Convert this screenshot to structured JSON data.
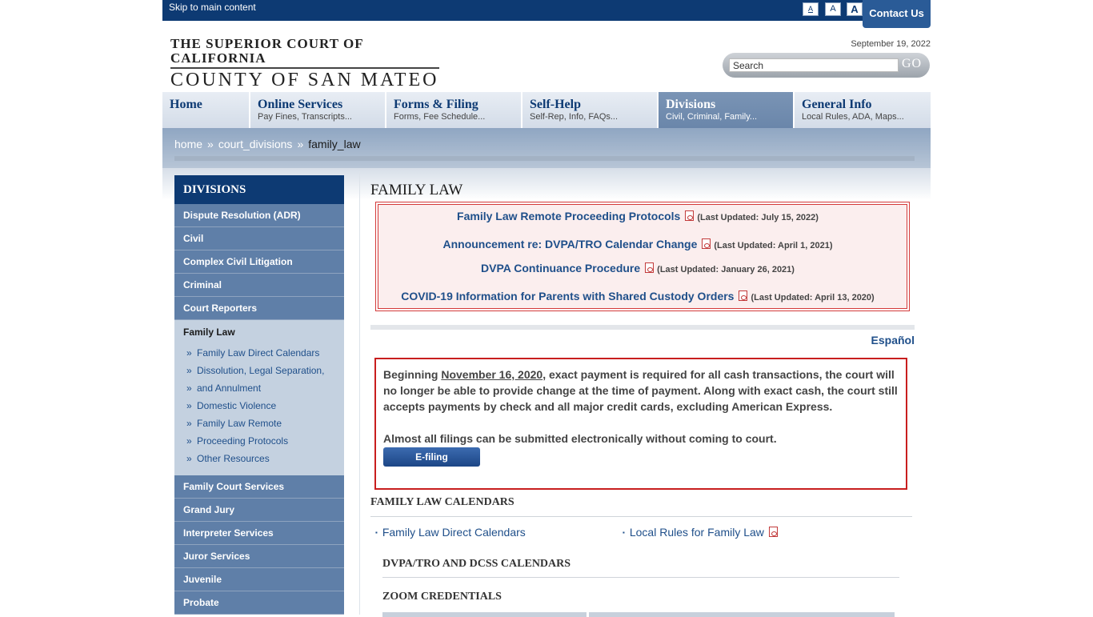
{
  "topbar": {
    "skip_link": "Skip to main content",
    "font_small": "A",
    "font_medium": "A",
    "font_large": "A",
    "contact": "Contact Us"
  },
  "header": {
    "logo_line1": "THE SUPERIOR COURT OF CALIFORNIA",
    "logo_line2": "COUNTY OF SAN MATEO",
    "date": "September 19, 2022",
    "search_placeholder": "Search",
    "go_label": "GO"
  },
  "nav": [
    {
      "title": "Home",
      "sub": ""
    },
    {
      "title": "Online Services",
      "sub": "Pay Fines, Transcripts..."
    },
    {
      "title": "Forms & Filing",
      "sub": "Forms, Fee Schedule..."
    },
    {
      "title": "Self-Help",
      "sub": "Self-Rep, Info, FAQs..."
    },
    {
      "title": "Divisions",
      "sub": "Civil, Criminal, Family..."
    },
    {
      "title": "General Info",
      "sub": "Local Rules, ADA, Maps..."
    }
  ],
  "breadcrumb": {
    "items": [
      "home",
      "court_divisions",
      "family_law"
    ],
    "separator": "»"
  },
  "sidebar": {
    "heading": "DIVISIONS",
    "items_top": [
      "Dispute Resolution (ADR)",
      "Civil",
      "Complex Civil Litigation",
      "Criminal",
      "Court Reporters"
    ],
    "active": "Family Law",
    "subitems": [
      "Family Law Direct Calendars",
      "Dissolution, Legal Separation,",
      "and Annulment",
      "Domestic Violence",
      "Family Law Remote",
      "Proceeding Protocols",
      "Other Resources"
    ],
    "items_bottom": [
      "Family Court Services",
      "Grand Jury",
      "Interpreter Services",
      "Juror Services",
      "Juvenile",
      "Probate"
    ]
  },
  "main": {
    "title": "FAMILY LAW",
    "alerts": [
      {
        "link": "Family Law Remote Proceeding Protocols",
        "updated": "(Last Updated: July 15, 2022)"
      },
      {
        "link": "Announcement re: DVPA/TRO Calendar Change",
        "updated": "(Last Updated: April 1, 2021)"
      },
      {
        "link": "DVPA Continuance Procedure",
        "updated": "(Last Updated: January 26, 2021)"
      },
      {
        "link": "COVID-19 Information for Parents with Shared Custody Orders",
        "updated": "(Last Updated: April 13, 2020)"
      }
    ],
    "espanol": "Español",
    "notice": {
      "part1": "Beginning ",
      "date": "November 16, 2020",
      "part2": ", exact payment is required for all cash transactions, the court will no longer be able to provide change at the time of payment. Along with exact cash, the court still accepts payments by check and all major credit cards, excluding American Express.",
      "efiling_text": "Almost all filings can be submitted electronically without coming to court.",
      "efiling_button": "E-filing"
    },
    "calendars_heading": "FAMILY LAW CALENDARS",
    "calendar_links": [
      "Family Law Direct Calendars",
      "Local Rules for Family Law"
    ],
    "dvpa_heading": "DVPA/TRO AND DCSS CALENDARS",
    "zoom_heading": "ZOOM CREDENTIALS"
  }
}
